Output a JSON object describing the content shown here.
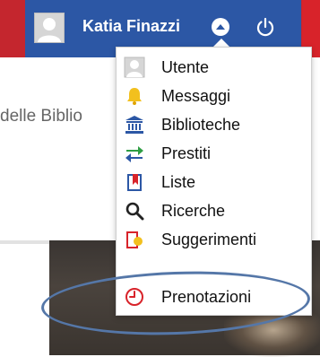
{
  "header": {
    "user_name": "Katia Finazzi",
    "avatar_icon": "user-avatar-icon",
    "dropdown_toggle_icon": "caret-up-circle-icon",
    "power_icon": "power-icon",
    "colors": {
      "user_bar": "#2c57a5",
      "accent_red": "#c4262e"
    }
  },
  "page": {
    "text_fragment": "delle Biblio"
  },
  "user_menu": {
    "items": [
      {
        "label": "Utente",
        "icon": "user-icon"
      },
      {
        "label": "Messaggi",
        "icon": "bell-icon"
      },
      {
        "label": "Biblioteche",
        "icon": "library-icon"
      },
      {
        "label": "Prestiti",
        "icon": "exchange-arrows-icon"
      },
      {
        "label": "Liste",
        "icon": "list-bookmark-icon"
      },
      {
        "label": "Ricerche",
        "icon": "search-icon"
      },
      {
        "label": "Suggerimenti",
        "icon": "suggestion-icon"
      },
      {
        "label": "Prenotazioni",
        "icon": "clock-icon"
      }
    ],
    "highlighted_item": "Prenotazioni"
  }
}
